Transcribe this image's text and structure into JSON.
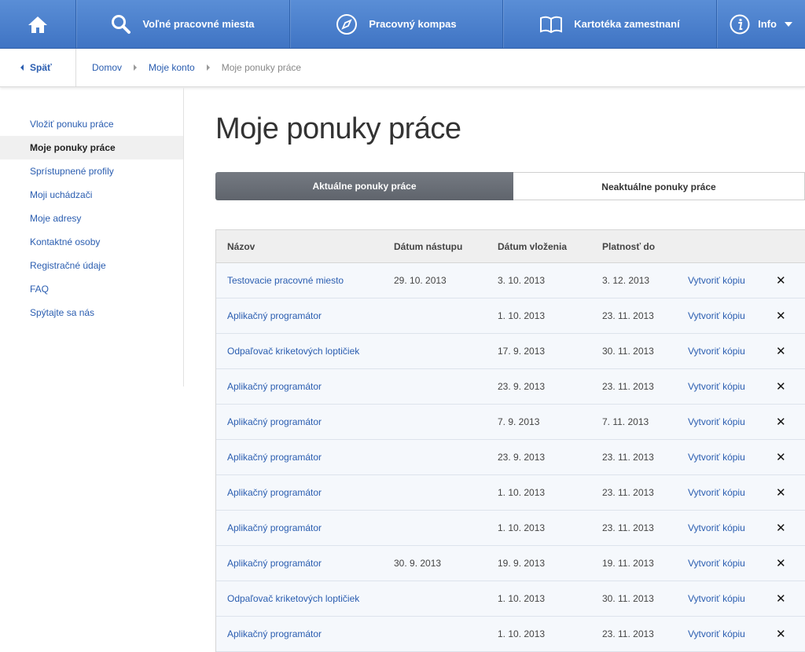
{
  "nav": {
    "home_icon": "home-icon",
    "jobs": {
      "label": "Voľné pracovné miesta",
      "icon": "search-icon"
    },
    "compass": {
      "label": "Pracovný kompas",
      "icon": "compass-icon"
    },
    "card": {
      "label": "Kartotéka zamestnaní",
      "icon": "book-icon"
    },
    "info": {
      "label": "Info",
      "icon": "info-icon"
    }
  },
  "breadcrumb": {
    "back": "Späť",
    "items": [
      "Domov",
      "Moje konto",
      "Moje ponuky práce"
    ]
  },
  "sidebar": {
    "items": [
      "Vložiť ponuku práce",
      "Moje ponuky práce",
      "Sprístupnené profily",
      "Moji uchádzači",
      "Moje adresy",
      "Kontaktné osoby",
      "Registračné údaje",
      "FAQ",
      "Spýtajte sa nás"
    ],
    "active_index": 1
  },
  "main": {
    "title": "Moje ponuky práce",
    "tabs": [
      "Aktuálne ponuky práce",
      "Neaktuálne ponuky práce"
    ]
  },
  "table": {
    "headers": [
      "Názov",
      "Dátum nástupu",
      "Dátum vloženia",
      "Platnosť do"
    ],
    "copy_label": "Vytvoriť kópiu",
    "delete_glyph": "✕",
    "rows": [
      [
        "Testovacie pracovné miesto",
        "29. 10. 2013",
        "3. 10. 2013",
        "3. 12. 2013"
      ],
      [
        "Aplikačný programátor",
        "",
        "1. 10. 2013",
        "23. 11. 2013"
      ],
      [
        "Odpaľovač kriketových loptičiek",
        "",
        "17. 9. 2013",
        "30. 11. 2013"
      ],
      [
        "Aplikačný programátor",
        "",
        "23. 9. 2013",
        "23. 11. 2013"
      ],
      [
        "Aplikačný programátor",
        "",
        "7. 9. 2013",
        "7. 11. 2013"
      ],
      [
        "Aplikačný programátor",
        "",
        "23. 9. 2013",
        "23. 11. 2013"
      ],
      [
        "Aplikačný programátor",
        "",
        "1. 10. 2013",
        "23. 11. 2013"
      ],
      [
        "Aplikačný programátor",
        "",
        "1. 10. 2013",
        "23. 11. 2013"
      ],
      [
        "Aplikačný programátor",
        "30. 9. 2013",
        "19. 9. 2013",
        "19. 11. 2013"
      ],
      [
        "Odpaľovač kriketových loptičiek",
        "",
        "1. 10. 2013",
        "30. 11. 2013"
      ],
      [
        "Aplikačný programátor",
        "",
        "1. 10. 2013",
        "23. 11. 2013"
      ]
    ]
  },
  "colors": {
    "nav_top": "#5a8ed6",
    "nav_bottom": "#3f74c4",
    "link": "#2a5db0",
    "tab_active": "#6a6f77"
  }
}
